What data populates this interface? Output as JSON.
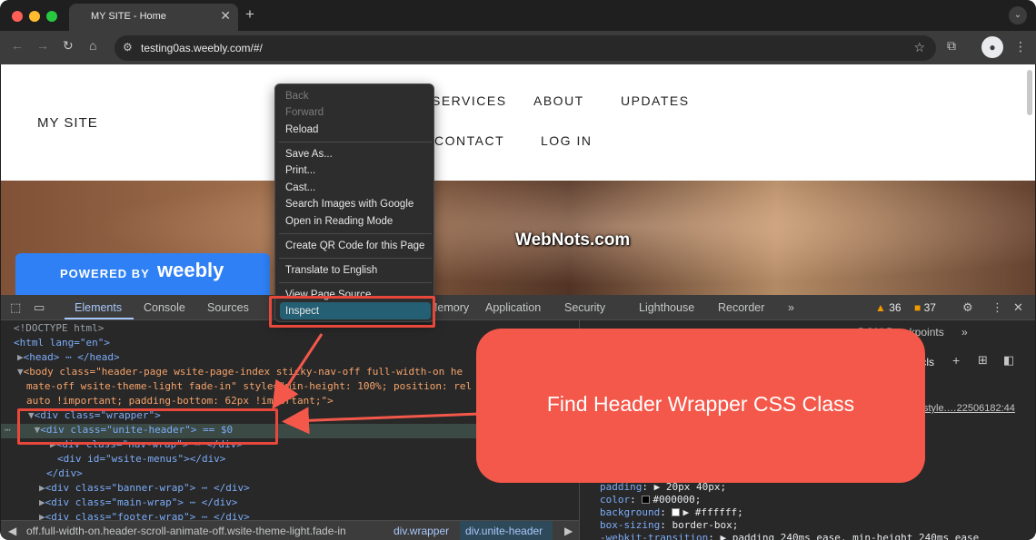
{
  "browser": {
    "tab_title": "MY SITE - Home",
    "tab_close": "✕",
    "new_tab": "+",
    "url": "testing0as.weebly.com/#/",
    "back": "←",
    "forward": "→",
    "reload": "↻",
    "home": "⌂",
    "star": "☆"
  },
  "site": {
    "title": "MY SITE",
    "nav": [
      "SERVICES",
      "ABOUT",
      "UPDATES",
      "CONTACT",
      "LOG IN"
    ],
    "powered_by": "POWERED BY",
    "powered_logo": "weebly",
    "watermark": "WebNots.com"
  },
  "context_menu": {
    "items": [
      "Back",
      "Forward",
      "Reload",
      "Save As...",
      "Print...",
      "Cast...",
      "Search Images with Google",
      "Open in Reading Mode",
      "Create QR Code for this Page",
      "Translate to English",
      "View Page Source",
      "Inspect"
    ],
    "disabled": [
      "Back",
      "Forward"
    ],
    "highlighted": "Inspect"
  },
  "devtools": {
    "tabs": [
      "Elements",
      "Console",
      "Sources",
      "Memory",
      "Application",
      "Security",
      "Lighthouse",
      "Recorder"
    ],
    "active_tab": "Elements",
    "more": "»",
    "warnings": "36",
    "issues": "37",
    "dom": {
      "doctype": "<!DOCTYPE html>",
      "html_open": "<html lang=\"en\">",
      "head": "<head> ⋯ </head>",
      "body_1": "<body class=\"header-page  wsite-page-index  sticky-nav-off full-width-on he",
      "body_2": "mate-off  wsite-theme-light fade-in\" style=\"min-height: 100%; position: rel",
      "body_3": "auto !important; padding-bottom: 62px !important;\">",
      "wrapper": "<div class=\"wrapper\">",
      "unite_header": "<div class=\"unite-header\"> == $0",
      "nav_wrap": "<div class=\"nav-wrap\"> ⋯ </div>",
      "wsite_menus": "<div id=\"wsite-menus\"></div>",
      "close_div": "</div>",
      "banner_wrap": "<div class=\"banner-wrap\"> ⋯ </div>",
      "main_wrap": "<div class=\"main-wrap\"> ⋯ </div>",
      "footer_wrap": "<div class=\"footer-wrap\"> ⋯ </div>"
    },
    "breadcrumbs": [
      "off.full-width-on.header-scroll-animate-off.wsite-theme-light.fade-in",
      "div.wrapper",
      "div.unite-header"
    ],
    "styles": {
      "tabs_label": "DOM Breakpoints",
      "cls": ".cls",
      "source": "style.…22506182:44",
      "props": [
        {
          "prop": "padding",
          "val": "▶ 20px 40px;"
        },
        {
          "prop": "color",
          "val": "#000000;"
        },
        {
          "prop": "background",
          "val": "▶ #ffffff;"
        },
        {
          "prop": "box-sizing",
          "val": "border-box;"
        },
        {
          "prop": "-webkit-transition",
          "val": "▶ padding 240ms ease, min-height 240ms ease"
        }
      ]
    }
  },
  "annotation": {
    "callout": "Find Header Wrapper CSS Class",
    "color": "#f4584a"
  }
}
